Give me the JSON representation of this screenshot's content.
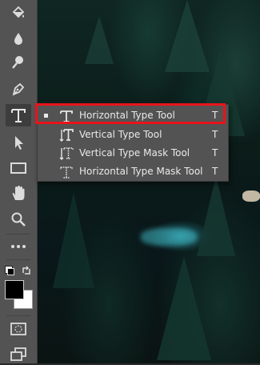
{
  "toolbar": {
    "tools": [
      {
        "name": "paint-bucket-tool",
        "icon": "paint-bucket-icon"
      },
      {
        "name": "blur-tool",
        "icon": "drop-icon"
      },
      {
        "name": "dodge-tool",
        "icon": "dodge-icon"
      },
      {
        "name": "pen-tool",
        "icon": "pen-icon"
      },
      {
        "name": "type-tool",
        "icon": "type-icon",
        "label": "T",
        "active": true
      },
      {
        "name": "path-selection-tool",
        "icon": "arrow-icon"
      },
      {
        "name": "rectangle-tool",
        "icon": "rectangle-icon"
      },
      {
        "name": "hand-tool",
        "icon": "hand-icon"
      },
      {
        "name": "zoom-tool",
        "icon": "magnifier-icon"
      },
      {
        "name": "more-tools",
        "icon": "ellipsis-icon"
      },
      {
        "name": "quick-mask",
        "icon": "quick-mask-icon"
      },
      {
        "name": "screen-mode",
        "icon": "screen-mode-icon"
      }
    ],
    "foreground_color": "#000000",
    "background_color": "#ffffff"
  },
  "flyout": {
    "items": [
      {
        "label": "Horizontal Type Tool",
        "shortcut": "T",
        "selected": true,
        "icon": "type-icon"
      },
      {
        "label": "Vertical Type Tool",
        "shortcut": "T",
        "selected": false,
        "icon": "vertical-type-icon"
      },
      {
        "label": "Vertical Type Mask Tool",
        "shortcut": "T",
        "selected": false,
        "icon": "vertical-type-mask-icon"
      },
      {
        "label": "Horizontal Type Mask Tool",
        "shortcut": "T",
        "selected": false,
        "icon": "horizontal-type-mask-icon"
      }
    ]
  },
  "colors": {
    "highlight": "#e8141b",
    "toolbar_bg": "#535353",
    "icon": "#dcdcdc"
  }
}
